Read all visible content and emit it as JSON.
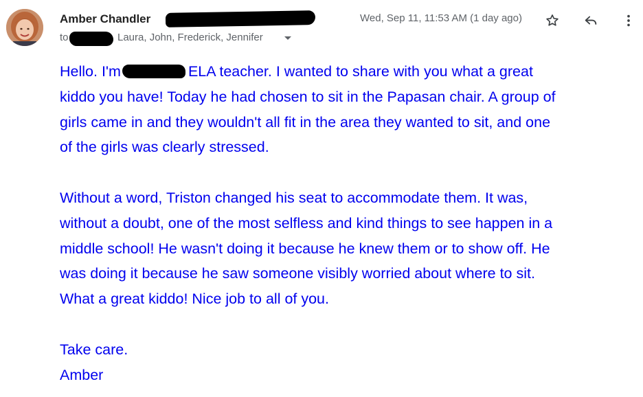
{
  "header": {
    "sender_name": "Amber Chandler",
    "to_prefix": "to",
    "recipients": "Laura, John, Frederick, Jennifer",
    "timestamp": "Wed, Sep 11, 11:53 AM (1 day ago)"
  },
  "icons": {
    "star": "star-outline-icon",
    "reply": "reply-arrow-icon",
    "more": "more-vertical-icon",
    "expand": "chevron-down-icon"
  },
  "colors": {
    "body_text": "#0000ee",
    "sender_text": "#222222",
    "meta_text": "#5f6368"
  },
  "message": {
    "p1_line1_before": "Hello. I'm",
    "p1_line1_after": "ELA teacher. I wanted to share with you what a great",
    "p1_line2": "kiddo you have! Today he had chosen to sit in the Papasan chair. A group of",
    "p1_line3": "girls came in and they wouldn't all fit in the area they wanted to sit, and one",
    "p1_line4": "of the girls was clearly stressed.",
    "p2_line1": "Without a word, Triston changed his seat to accommodate them. It was,",
    "p2_line2": "without a doubt, one of the most selfless and kind things to see happen in a",
    "p2_line3": "middle school! He wasn't doing it because he knew them or to show off. He",
    "p2_line4": "was doing it because he saw someone visibly worried about where to sit.",
    "p2_line5": "What a great kiddo! Nice job to all of you.",
    "signoff": "Take care.",
    "signature": "Amber"
  }
}
